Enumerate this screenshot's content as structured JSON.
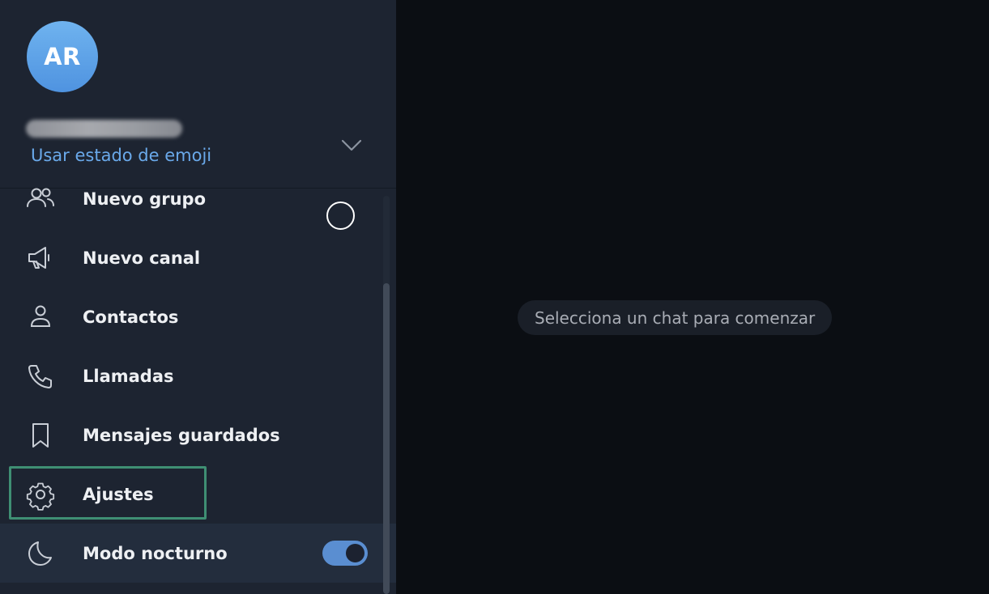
{
  "profile": {
    "avatar_initials": "AR",
    "emoji_status_link": "Usar estado de emoji",
    "chevron_icon": "chevron-down-icon"
  },
  "menu": {
    "items": [
      {
        "label": "Nuevo grupo",
        "icon": "group-icon"
      },
      {
        "label": "Nuevo canal",
        "icon": "megaphone-icon"
      },
      {
        "label": "Contactos",
        "icon": "person-icon"
      },
      {
        "label": "Llamadas",
        "icon": "phone-icon"
      },
      {
        "label": "Mensajes guardados",
        "icon": "bookmark-icon"
      },
      {
        "label": "Ajustes",
        "icon": "gear-icon"
      },
      {
        "label": "Modo nocturno",
        "icon": "moon-icon",
        "toggle_on": true
      }
    ]
  },
  "chat_pane": {
    "empty_state": "Selecciona un chat para comenzar"
  },
  "colors": {
    "sidebar_bg": "#1d2431",
    "chat_bg": "#0b0e13",
    "accent": "#6aa9ea",
    "toggle_on": "#5a8ed1",
    "highlight": "#3f8f73"
  }
}
